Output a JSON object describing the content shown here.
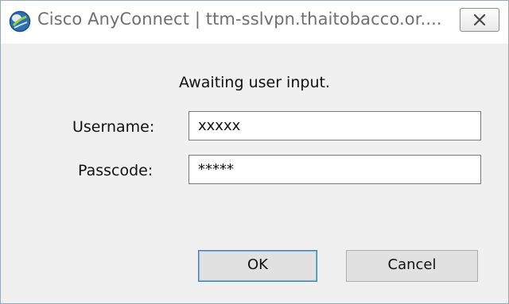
{
  "window": {
    "title": "Cisco AnyConnect | ttm-sslvpn.thaitobacco.or....",
    "icon": "cisco-anyconnect-globe-icon",
    "close_icon": "close-icon"
  },
  "dialog": {
    "status_text": "Awaiting user input.",
    "username": {
      "label": "Username:",
      "value": "xxxxx"
    },
    "passcode": {
      "label": "Passcode:",
      "value": "*****"
    }
  },
  "buttons": {
    "ok_label": "OK",
    "cancel_label": "Cancel"
  },
  "colors": {
    "accent": "#3c7fb1",
    "title_text": "#6f6f6f",
    "window_bg": "#f0f0f0"
  }
}
